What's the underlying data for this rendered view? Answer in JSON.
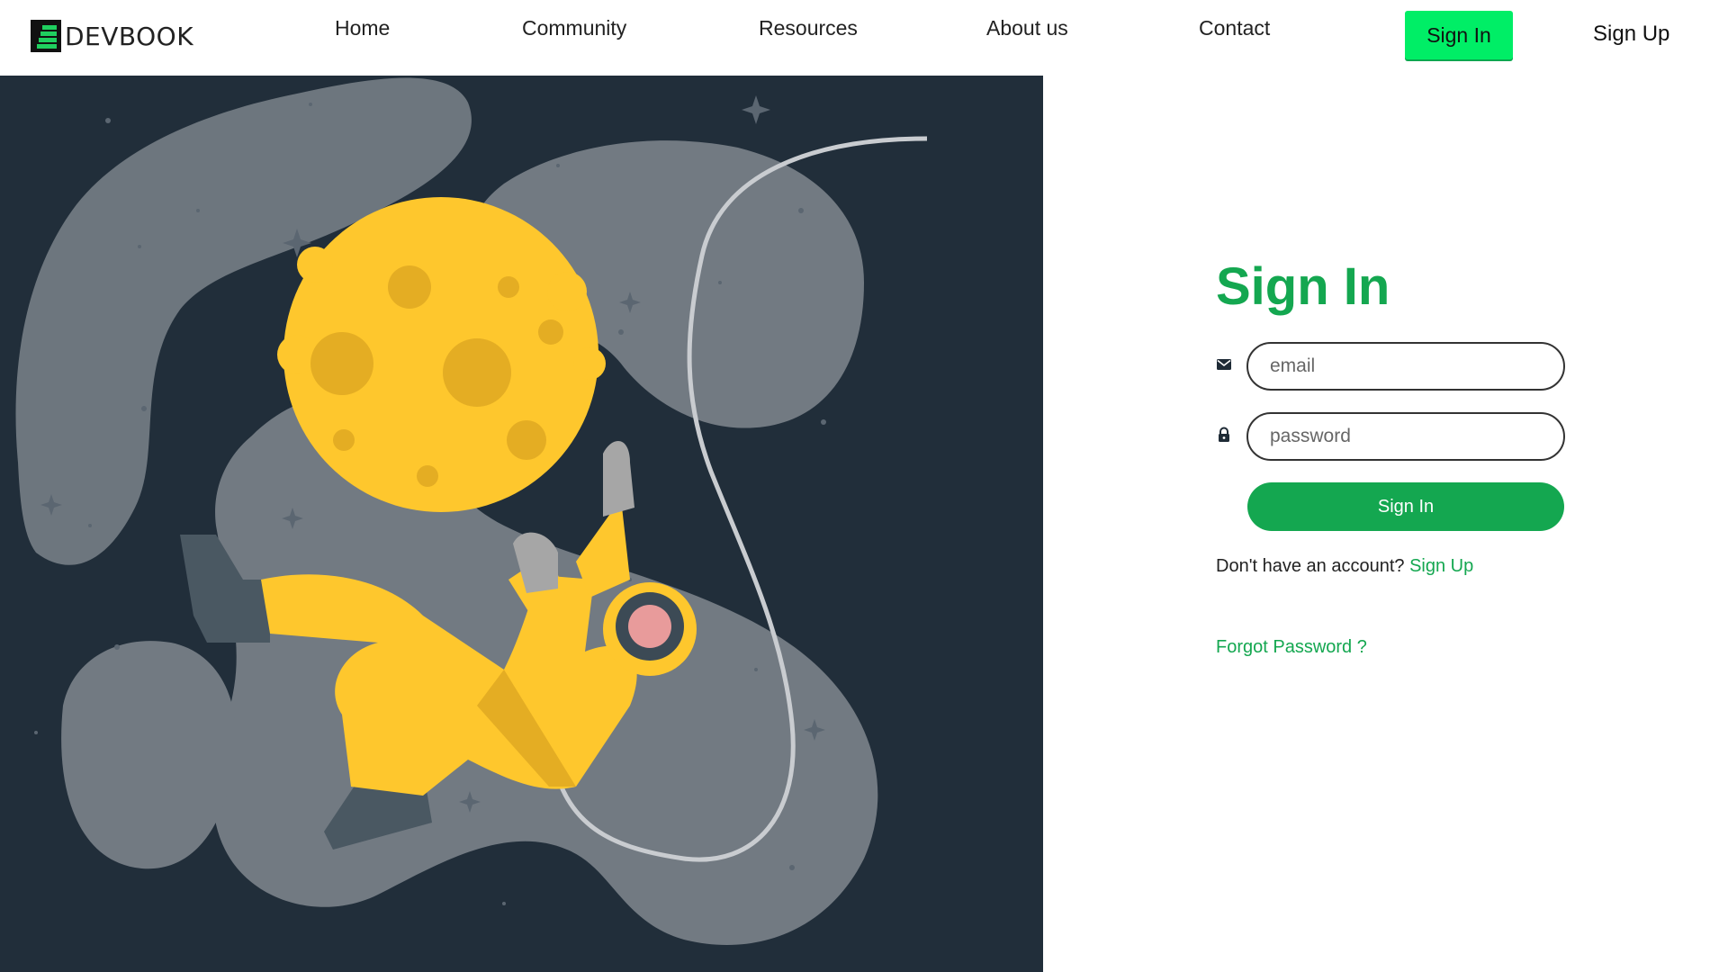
{
  "app": {
    "brand": "DEVBOOK",
    "logo_icon": "book-stack-icon"
  },
  "nav": {
    "links": [
      "Home",
      "Community",
      "Resources",
      "About us",
      "Contact"
    ],
    "signin_label": "Sign In",
    "signup_label": "Sign Up"
  },
  "illustration": {
    "subject": "astronaut-floating-with-moon",
    "background_color": "#212e3a"
  },
  "form": {
    "title": "Sign In",
    "email": {
      "placeholder": "email",
      "icon": "envelope-icon",
      "value": ""
    },
    "password": {
      "placeholder": "password",
      "icon": "lock-icon",
      "value": ""
    },
    "submit_label": "Sign In",
    "no_account_text": "Don't have an account?",
    "signup_link": "Sign Up",
    "forgot_link": "Forgot Password ?"
  },
  "colors": {
    "accent": "#14a750",
    "nav_signin_bg": "#00ee66",
    "text": "#222222"
  }
}
